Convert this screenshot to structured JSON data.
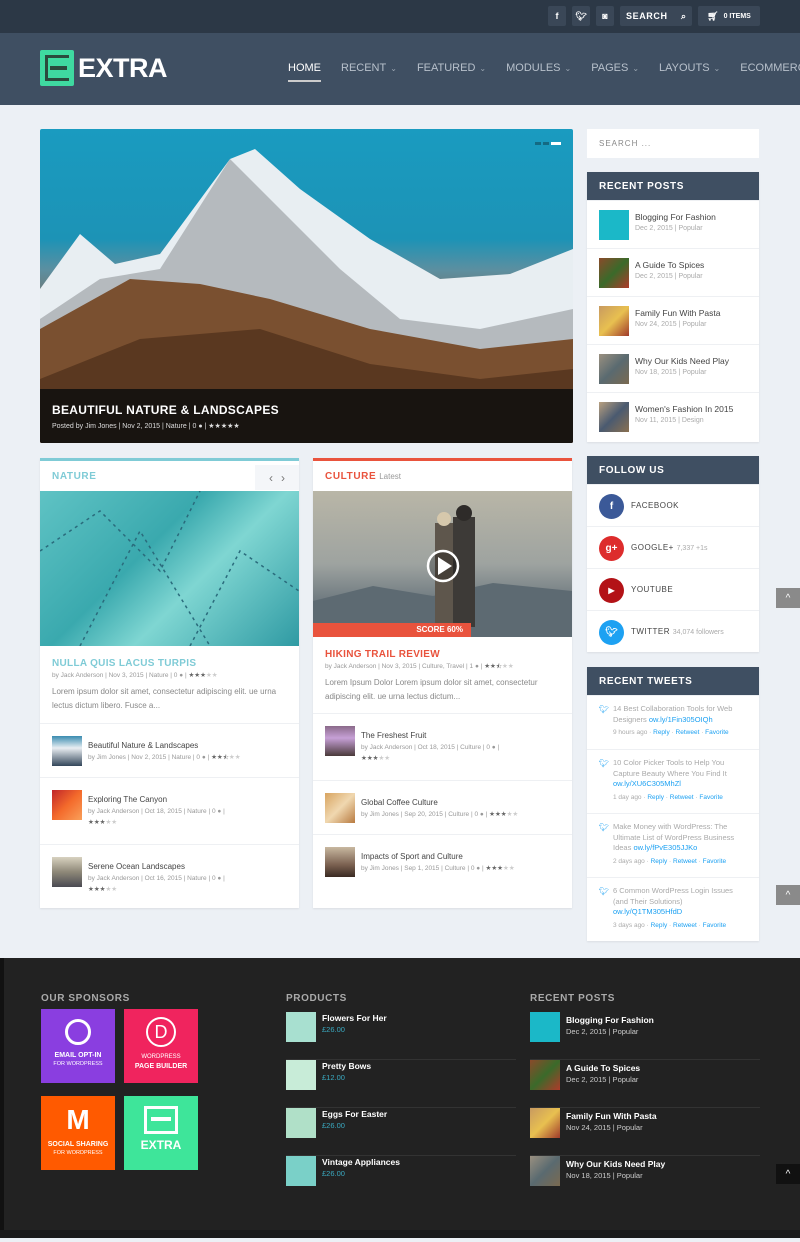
{
  "topbar": {
    "social": [
      {
        "icon": "facebook-icon",
        "glyph": "f"
      },
      {
        "icon": "twitter-icon",
        "glyph": "t"
      },
      {
        "icon": "instagram-icon",
        "glyph": "◙"
      }
    ],
    "search_placeholder": "SEARCH",
    "cart_label": "0 ITEMS"
  },
  "header": {
    "logo_text": "EXTRA",
    "nav": [
      {
        "label": "HOME",
        "active": true,
        "dropdown": false
      },
      {
        "label": "RECENT",
        "active": false,
        "dropdown": true
      },
      {
        "label": "FEATURED",
        "active": false,
        "dropdown": true
      },
      {
        "label": "MODULES",
        "active": false,
        "dropdown": true
      },
      {
        "label": "PAGES",
        "active": false,
        "dropdown": true
      },
      {
        "label": "LAYOUTS",
        "active": false,
        "dropdown": true
      },
      {
        "label": "ECOMMERCE",
        "active": false,
        "dropdown": false
      }
    ]
  },
  "hero": {
    "title": "BEAUTIFUL NATURE & LANDSCAPES",
    "meta": "Posted by Jim Jones | Nov 2, 2015 | Nature | 0",
    "rating": 5,
    "slides": 3,
    "active_slide": 3
  },
  "nature": {
    "heading": "NATURE",
    "accent": "#7fcbd6",
    "featured": {
      "title": "NULLA QUIS LACUS TURPIS",
      "meta": "by Jack Anderson | Nov 3, 2015 | Nature | 0",
      "rating": 3,
      "excerpt": "Lorem ipsum dolor sit amet, consectetur adipiscing elit. ue urna lectus dictum libero. Fusce a..."
    },
    "items": [
      {
        "title": "Beautiful Nature & Landscapes",
        "meta": "by Jim Jones | Nov 2, 2015 | Nature | 0",
        "rating": 2.5
      },
      {
        "title": "Exploring The Canyon",
        "meta": "by Jack Anderson | Oct 18, 2015 | Nature | 0",
        "rating": 3
      },
      {
        "title": "Serene Ocean Landscapes",
        "meta": "by Jack Anderson | Oct 16, 2015 | Nature | 0",
        "rating": 3
      }
    ]
  },
  "culture": {
    "heading": "CULTURE",
    "subheading": "Latest",
    "accent": "#e9533d",
    "score_label": "SCORE 60%",
    "score": 60,
    "featured": {
      "title": "HIKING TRAIL REVIEW",
      "meta": "by Jack Anderson | Nov 3, 2015 | Culture, Travel | 1",
      "rating": 2.5,
      "excerpt": "Lorem Ipsum Dolor Lorem ipsum dolor sit amet, consectetur adipiscing elit. ue urna lectus dictum..."
    },
    "items": [
      {
        "title": "The Freshest Fruit",
        "meta": "by Jack Anderson | Oct 18, 2015 | Culture | 0",
        "rating": 3
      },
      {
        "title": "Global Coffee Culture",
        "meta": "by Jim Jones | Sep 20, 2015 | Culture | 0",
        "rating": 3
      },
      {
        "title": "Impacts of Sport and Culture",
        "meta": "by Jim Jones | Sep 1, 2015 | Culture | 0",
        "rating": 3
      }
    ]
  },
  "sidebar": {
    "search_placeholder": "SEARCH ...",
    "recent_posts": {
      "heading": "RECENT POSTS",
      "items": [
        {
          "title": "Blogging For Fashion",
          "meta": "Dec 2, 2015 | Popular"
        },
        {
          "title": "A Guide To Spices",
          "meta": "Dec 2, 2015 | Popular"
        },
        {
          "title": "Family Fun With Pasta",
          "meta": "Nov 24, 2015 | Popular"
        },
        {
          "title": "Why Our Kids Need Play",
          "meta": "Nov 18, 2015 | Popular"
        },
        {
          "title": "Women's Fashion In 2015",
          "meta": "Nov 11, 2015 | Design"
        }
      ]
    },
    "follow_us": {
      "heading": "FOLLOW US",
      "items": [
        {
          "label": "FACEBOOK",
          "count": "",
          "color": "#3b5998",
          "glyph": "f"
        },
        {
          "label": "GOOGLE+",
          "count": "7,337 +1s",
          "color": "#dd2c2c",
          "glyph": "g+"
        },
        {
          "label": "YOUTUBE",
          "count": "",
          "color": "#b31217",
          "glyph": "▶"
        },
        {
          "label": "TWITTER",
          "count": "34,074 followers",
          "color": "#1da1f2",
          "glyph": "t"
        }
      ]
    },
    "recent_tweets": {
      "heading": "RECENT TWEETS",
      "items": [
        {
          "text": "14 Best Collaboration Tools for Web Designers",
          "link": "ow.ly/1Fin305OIQh",
          "time": "9 hours ago"
        },
        {
          "text": "10 Color Picker Tools to Help You Capture Beauty Where You Find It",
          "link": "ow.ly/XU6C305MhZl",
          "time": "1 day ago"
        },
        {
          "text": "Make Money with WordPress: The Ultimate List of WordPress Business Ideas",
          "link": "ow.ly/fPvE305JJKo",
          "time": "2 days ago"
        },
        {
          "text": "6 Common WordPress Login Issues (and Their Solutions)",
          "link": "ow.ly/Q1TM305HfdD",
          "time": "3 days ago"
        }
      ],
      "actions": [
        "Reply",
        "Retweet",
        "Favorite"
      ]
    }
  },
  "footer": {
    "sponsors": {
      "heading": "OUR SPONSORS",
      "items": [
        {
          "title": "EMAIL OPT-IN",
          "sub": "FOR WORDPRESS",
          "color": "#8a3ee0"
        },
        {
          "title": "PAGE BUILDER",
          "sub": "WORDPRESS",
          "color": "#f0245e"
        },
        {
          "title": "SOCIAL SHARING",
          "sub": "FOR WORDPRESS",
          "color": "#ff5a00"
        },
        {
          "title": "EXTRA",
          "sub": "",
          "color": "#3ee59a"
        }
      ]
    },
    "products": {
      "heading": "PRODUCTS",
      "items": [
        {
          "title": "Flowers For Her",
          "price": "£26.00"
        },
        {
          "title": "Pretty Bows",
          "price": "£12.00"
        },
        {
          "title": "Eggs For Easter",
          "price": "£26.00"
        },
        {
          "title": "Vintage Appliances",
          "price": "£26.00"
        }
      ]
    },
    "recent_posts": {
      "heading": "RECENT POSTS",
      "items": [
        {
          "title": "Blogging For Fashion",
          "meta": "Dec 2, 2015 | Popular"
        },
        {
          "title": "A Guide To Spices",
          "meta": "Dec 2, 2015 | Popular"
        },
        {
          "title": "Family Fun With Pasta",
          "meta": "Nov 24, 2015 | Popular"
        },
        {
          "title": "Why Our Kids Need Play",
          "meta": "Nov 18, 2015 | Popular"
        }
      ]
    }
  },
  "scroll_top_glyph": "^"
}
